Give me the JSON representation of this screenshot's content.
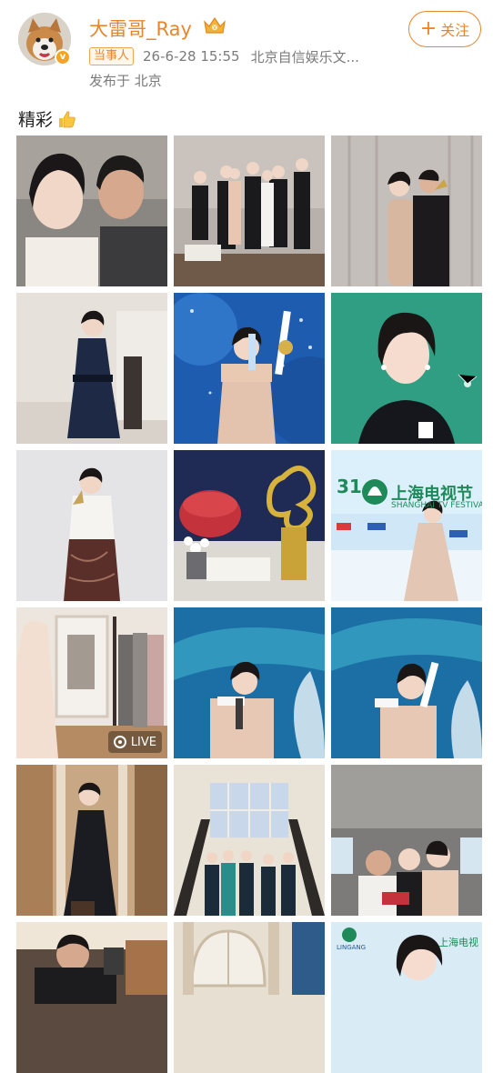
{
  "post": {
    "username": "大雷哥_Ray",
    "tag": "当事人",
    "timestamp": "26-6-28 15:55",
    "source": "北京自信娱乐文...",
    "published": "发布于 北京",
    "follow_label": "关注",
    "caption": "精彩",
    "icons": {
      "verified": "verified-badge-icon",
      "crown": "crown-icon",
      "follow": "plus-icon",
      "caption": "thumbs-up-icon",
      "live": "live-icon"
    }
  },
  "photos": [
    {
      "id": "1",
      "desc": "selfie-couple"
    },
    {
      "id": "2",
      "desc": "group-photo"
    },
    {
      "id": "3",
      "desc": "couple-with-trophy"
    },
    {
      "id": "4",
      "desc": "woman-navy-dress"
    },
    {
      "id": "5",
      "desc": "award-stage"
    },
    {
      "id": "6",
      "desc": "portrait-green"
    },
    {
      "id": "7",
      "desc": "woman-with-trophy"
    },
    {
      "id": "8",
      "desc": "trophy-table"
    },
    {
      "id": "9",
      "desc": "festival-backdrop",
      "backdrop_text": "上海电视节",
      "backdrop_sub": "SHANGHAI TV FESTIVAL",
      "backdrop_num": "31"
    },
    {
      "id": "10",
      "desc": "dress-rack",
      "live_label": "LIVE"
    },
    {
      "id": "11",
      "desc": "speech-stage"
    },
    {
      "id": "12",
      "desc": "speech-stage-close"
    },
    {
      "id": "13",
      "desc": "woman-black-gown"
    },
    {
      "id": "14",
      "desc": "group-grand-hall"
    },
    {
      "id": "15",
      "desc": "car-selfie"
    },
    {
      "id": "16",
      "desc": "man-restaurant"
    },
    {
      "id": "17",
      "desc": "arched-hall"
    },
    {
      "id": "18",
      "desc": "portrait-festival",
      "backdrop_text": "上海电视",
      "backdrop_sub": "LINGANG"
    }
  ]
}
